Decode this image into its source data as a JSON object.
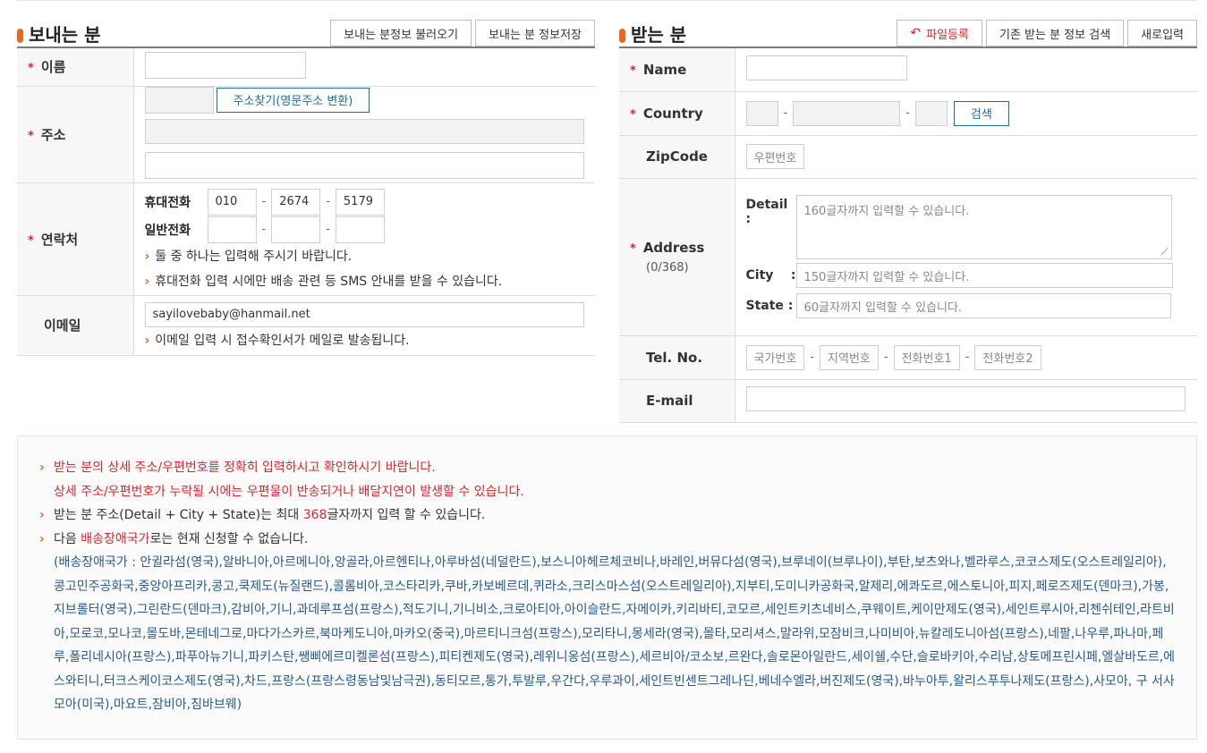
{
  "sender": {
    "title": "보내는 분",
    "load_button": "보내는 분정보 불러오기",
    "save_button": "보내는 분 정보저장",
    "name_label": "이름",
    "address_label": "주소",
    "address_search_button": "주소찾기(영문주소 변환)",
    "contact_label": "연락처",
    "mobile_label": "휴대전화",
    "mobile": [
      "010",
      "2674",
      "5179"
    ],
    "landline_label": "일반전화",
    "contact_note1": "둘 중 하나는 입력해 주시기 바랍니다.",
    "contact_note2": "휴대전화 입력 시에만 배송 관련 등 SMS 안내를 받을 수 있습니다.",
    "email_label": "이메일",
    "email_value": "sayilovebaby@hanmail.net",
    "email_note": "이메일 입력 시 접수확인서가 메일로 발송됩니다."
  },
  "receiver": {
    "title": "받는 분",
    "file_button": "파일등록",
    "search_button": "기존 받는 분 정보 검색",
    "new_button": "새로입력",
    "name_label": "Name",
    "country_label": "Country",
    "country_search_button": "검색",
    "zip_label": "ZipCode",
    "zip_placeholder": "우편번호",
    "address_label": "Address",
    "address_count": "(0/368)",
    "detail_label": "Detail :",
    "detail_placeholder": "160글자까지 입력할 수 있습니다.",
    "city_label": "City",
    "city_colon": ":",
    "city_placeholder": "150글자까지 입력할 수 있습니다.",
    "state_label": "State :",
    "state_placeholder": "60글자까지 입력할 수 있습니다.",
    "tel_label": "Tel. No.",
    "tel_placeholders": [
      "국가번호",
      "지역번호",
      "전화번호1",
      "전화번호2"
    ],
    "email_label": "E-mail"
  },
  "notice": {
    "line1": "받는 분의 상세 주소/우편번호를 정확히 입력하시고 확인하시기 바랍니다.",
    "line2": "상세 주소/우편번호가 누락될 시에는 우편물이 반송되거나 배달지연이 발생할 수 있습니다.",
    "line3_a": "받는 분 주소(Detail + City + State)는 최대 ",
    "line3_num": "368",
    "line3_b": "글자까지 입력 할 수 있습니다.",
    "line4_a": "다음 ",
    "line4_red": "배송장애국가",
    "line4_b": "로는 현재 신청할 수 없습니다.",
    "countries": "(배송장애국가 : 안귈라섬(영국),알바니아,아르메니아,앙골라,아르헨티나,아루바섬(네덜란드),보스니아헤르체코비나,바레인,버뮤다섬(영국),브루네이(브루나이),부탄,보츠와나,벨라루스,코코스제도(오스트레일리아),콩고민주공화국,중앙아프리카,콩고,쿡제도(뉴질랜드),콜롬비아,코스타리카,쿠바,카보베르데,퀴라소,크리스마스섬(오스트레일리아),지부티,도미니카공화국,알제리,에콰도르,에스토니아,피지,페로즈제도(덴마크),가봉,지브롤터(영국),그린란드(덴마크),감비아,기니,과데루프섬(프랑스),적도기니,기니비소,크로아티아,아이슬란드,자메이카,키리바티,코모르,세인트키츠네비스,쿠웨이트,케이만제도(영국),세인트루시아,리첸쉬테인,라트비아,모로코,모나코,몰도바,몬테네그로,마다가스카르,북마케도니아,마카오(중국),마르티니크섬(프랑스),모리타니,몽세라(영국),몰타,모리셔스,말라위,모잠비크,나미비아,뉴칼레도니아섬(프랑스),네팔,나우루,파나마,페루,폴리네시아(프랑스),파푸아뉴기니,파키스탄,쌩삐에르미켈론섬(프랑스),피티켄제도(영국),레위니옹섬(프랑스),세르비아/코소보,르완다,솔로몬아일란드,세이쉘,수단,슬로바키아,수리남,상토메프린시페,엘살바도르,에스와티니,터크스케이코스제도(영국),차드,프랑스(프랑스령동남및남극권),동티모르,통가,투발루,우간다,우루과이,세인트빈센트그레나딘,베네수엘라,버진제도(영국),바누아투,왈리스푸투나제도(프랑스),사모아, 구 서사모아(미국),마요트,잠비아,짐바브웨)"
  }
}
